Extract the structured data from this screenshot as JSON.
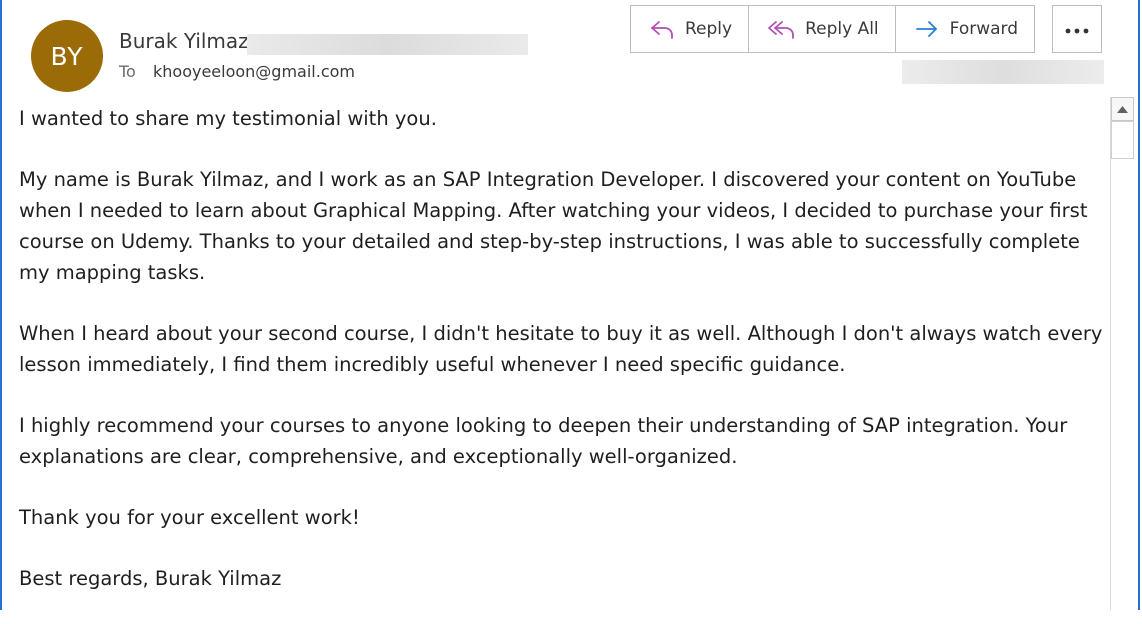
{
  "sender": {
    "initials": "BY",
    "name": "Burak Yilmaz",
    "avatar_color": "#9a6b06"
  },
  "recipient": {
    "to_label": "To",
    "address": "khooyeeloon@gmail.com"
  },
  "actions": {
    "reply": "Reply",
    "reply_all": "Reply All",
    "forward": "Forward",
    "more_icon": "ellipsis-icon"
  },
  "colors": {
    "accent": "#2b6fd0",
    "reply_icon": "#b04fb5",
    "forward_icon": "#2a7fd4"
  },
  "body": {
    "p1": "I wanted to share my testimonial with you.",
    "p2": "My name is Burak Yilmaz, and I work as an SAP Integration Developer. I discovered your content on YouTube when I needed to learn about Graphical Mapping. After watching your videos, I decided to purchase your first course on Udemy. Thanks to your detailed and step-by-step instructions, I was able to successfully complete my mapping tasks.",
    "p3": "When I heard about your second course, I didn't hesitate to buy it as well. Although I don't always watch every lesson immediately, I find them incredibly useful whenever I need specific guidance.",
    "p4": "I highly recommend your courses to anyone looking to deepen their understanding of SAP integration. Your explanations are clear, comprehensive, and exceptionally well-organized.",
    "p5": "Thank you for your excellent work!",
    "p6": "Best regards, Burak Yilmaz"
  }
}
